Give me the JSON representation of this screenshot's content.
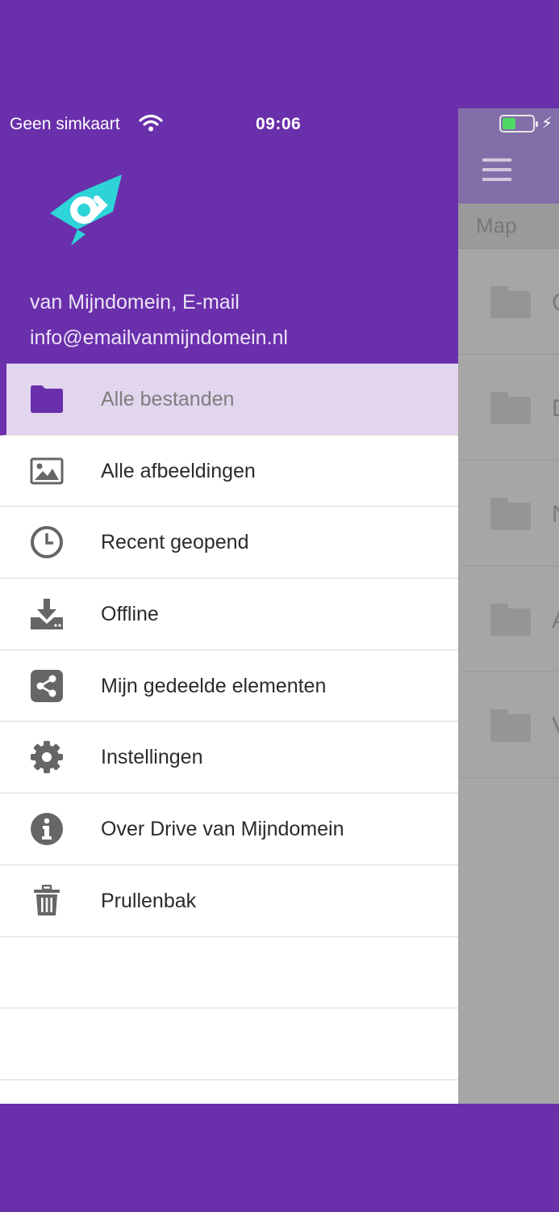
{
  "status_bar": {
    "carrier": "Geen simkaart",
    "time": "09:06"
  },
  "drawer": {
    "account_name": "van Mijndomein, E-mail",
    "account_email": "info@emailvanmijndomein.nl",
    "items": [
      {
        "label": "Alle bestanden",
        "icon": "folder-icon",
        "active": true
      },
      {
        "label": "Alle afbeeldingen",
        "icon": "image-icon"
      },
      {
        "label": "Recent geopend",
        "icon": "clock-icon"
      },
      {
        "label": "Offline",
        "icon": "download-icon"
      },
      {
        "label": "Mijn gedeelde elementen",
        "icon": "share-icon"
      },
      {
        "label": "Instellingen",
        "icon": "gear-icon"
      },
      {
        "label": "Over Drive van Mijndomein",
        "icon": "info-icon"
      },
      {
        "label": "Prullenbak",
        "icon": "trash-icon"
      }
    ]
  },
  "background_app": {
    "breadcrumb": "Map",
    "folder_letters": [
      "C",
      "D",
      "N",
      "A",
      "V"
    ]
  },
  "colors": {
    "brand_purple": "#6a2fab",
    "active_item_bg": "#e2d5ee",
    "logo_teal": "#2dd4d8",
    "icon_gray": "#666666"
  }
}
